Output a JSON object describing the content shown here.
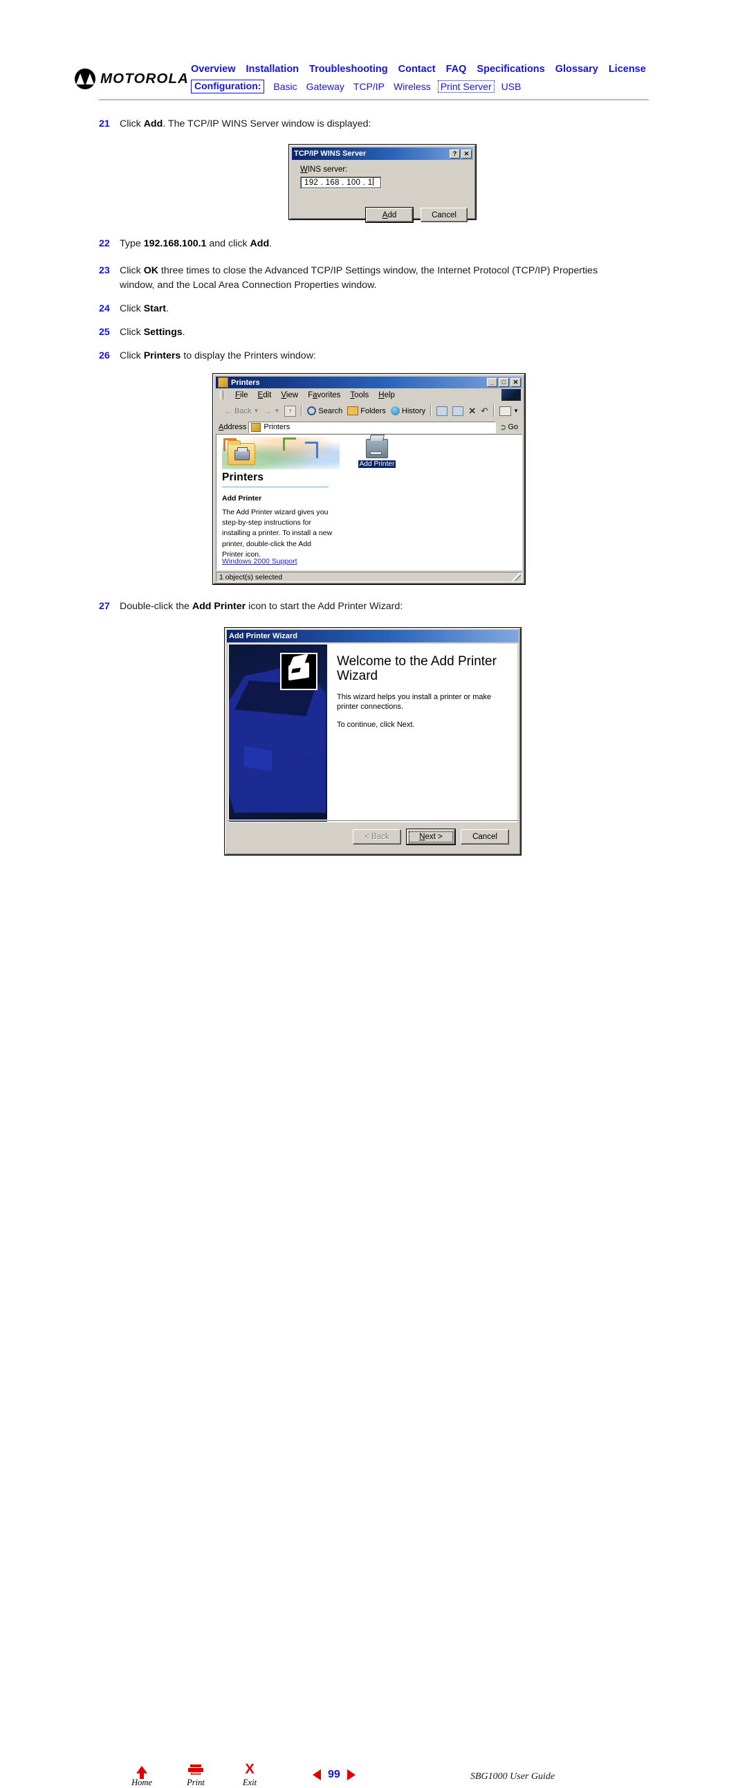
{
  "header": {
    "brand": "MOTOROLA",
    "primary_nav": [
      "Overview",
      "Installation",
      "Troubleshooting",
      "Contact",
      "FAQ",
      "Specifications",
      "Glossary",
      "License"
    ],
    "config_label": "Configuration:",
    "secondary_nav": [
      {
        "label": "Basic",
        "focused": false
      },
      {
        "label": "Gateway",
        "focused": false
      },
      {
        "label": "TCP/IP",
        "focused": false
      },
      {
        "label": "Wireless",
        "focused": false
      },
      {
        "label": "Print Server",
        "focused": true
      },
      {
        "label": "USB",
        "focused": false
      }
    ],
    "link_color": "#1414e0"
  },
  "steps": {
    "s21": {
      "num": "21",
      "html": "Click <b>Add</b>. The TCP/IP WINS Server window is displayed:"
    },
    "s22": {
      "num": "22",
      "html": "Type <b>192.168.100.1</b> and click <b>Add</b>."
    },
    "s23": {
      "num": "23",
      "html": "Click <b>OK</b> three times to close the Advanced TCP/IP Settings window, the Internet Protocol (TCP/IP) Properties window, and the Local Area Connection Properties window."
    },
    "s24": {
      "num": "24",
      "html": "Click <b>Start</b>."
    },
    "s25": {
      "num": "25",
      "html": "Click <b>Settings</b>."
    },
    "s26": {
      "num": "26",
      "html": "Click <b>Printers</b> to display the Printers window:"
    },
    "s27": {
      "num": "27",
      "html": "Double-click the <b>Add Printer</b> icon to start the Add Printer Wizard:"
    }
  },
  "wins_dialog": {
    "title": "TCP/IP WINS Server",
    "help_btn": "?",
    "close_btn": "✕",
    "field_label": "WINS server:",
    "field_value": "192 . 168 . 100 .  1",
    "add_button": "Add",
    "cancel_button": "Cancel"
  },
  "printers_window": {
    "title": "Printers",
    "min_btn": "_",
    "max_btn": "□",
    "close_btn": "✕",
    "menus": [
      "File",
      "Edit",
      "View",
      "Favorites",
      "Tools",
      "Help"
    ],
    "toolbar": {
      "back": "Back",
      "forward": "",
      "up": "",
      "search": "Search",
      "folders": "Folders",
      "history": "History",
      "views": ""
    },
    "address_label": "Address",
    "address_value": "Printers",
    "go_label": "Go",
    "panel_heading": "Printers",
    "panel_subheading": "Add Printer",
    "panel_text": "The Add Printer wizard gives you step-by-step instructions for installing a printer. To install a new printer, double-click the Add Printer icon.",
    "panel_link": "Windows 2000 Support",
    "item_label": "Add Printer",
    "status_text": "1 object(s) selected"
  },
  "wizard_window": {
    "title": "Add Printer Wizard",
    "heading": "Welcome to the Add Printer Wizard",
    "para1": "This wizard helps you install a printer or make printer connections.",
    "para2": "To continue, click Next.",
    "back_button": "< Back",
    "next_button": "Next >",
    "cancel_button": "Cancel"
  },
  "footer": {
    "home_label": "Home",
    "print_label": "Print",
    "exit_label": "Exit",
    "page_number": "99",
    "guide_title": "SBG1000 User Guide"
  }
}
